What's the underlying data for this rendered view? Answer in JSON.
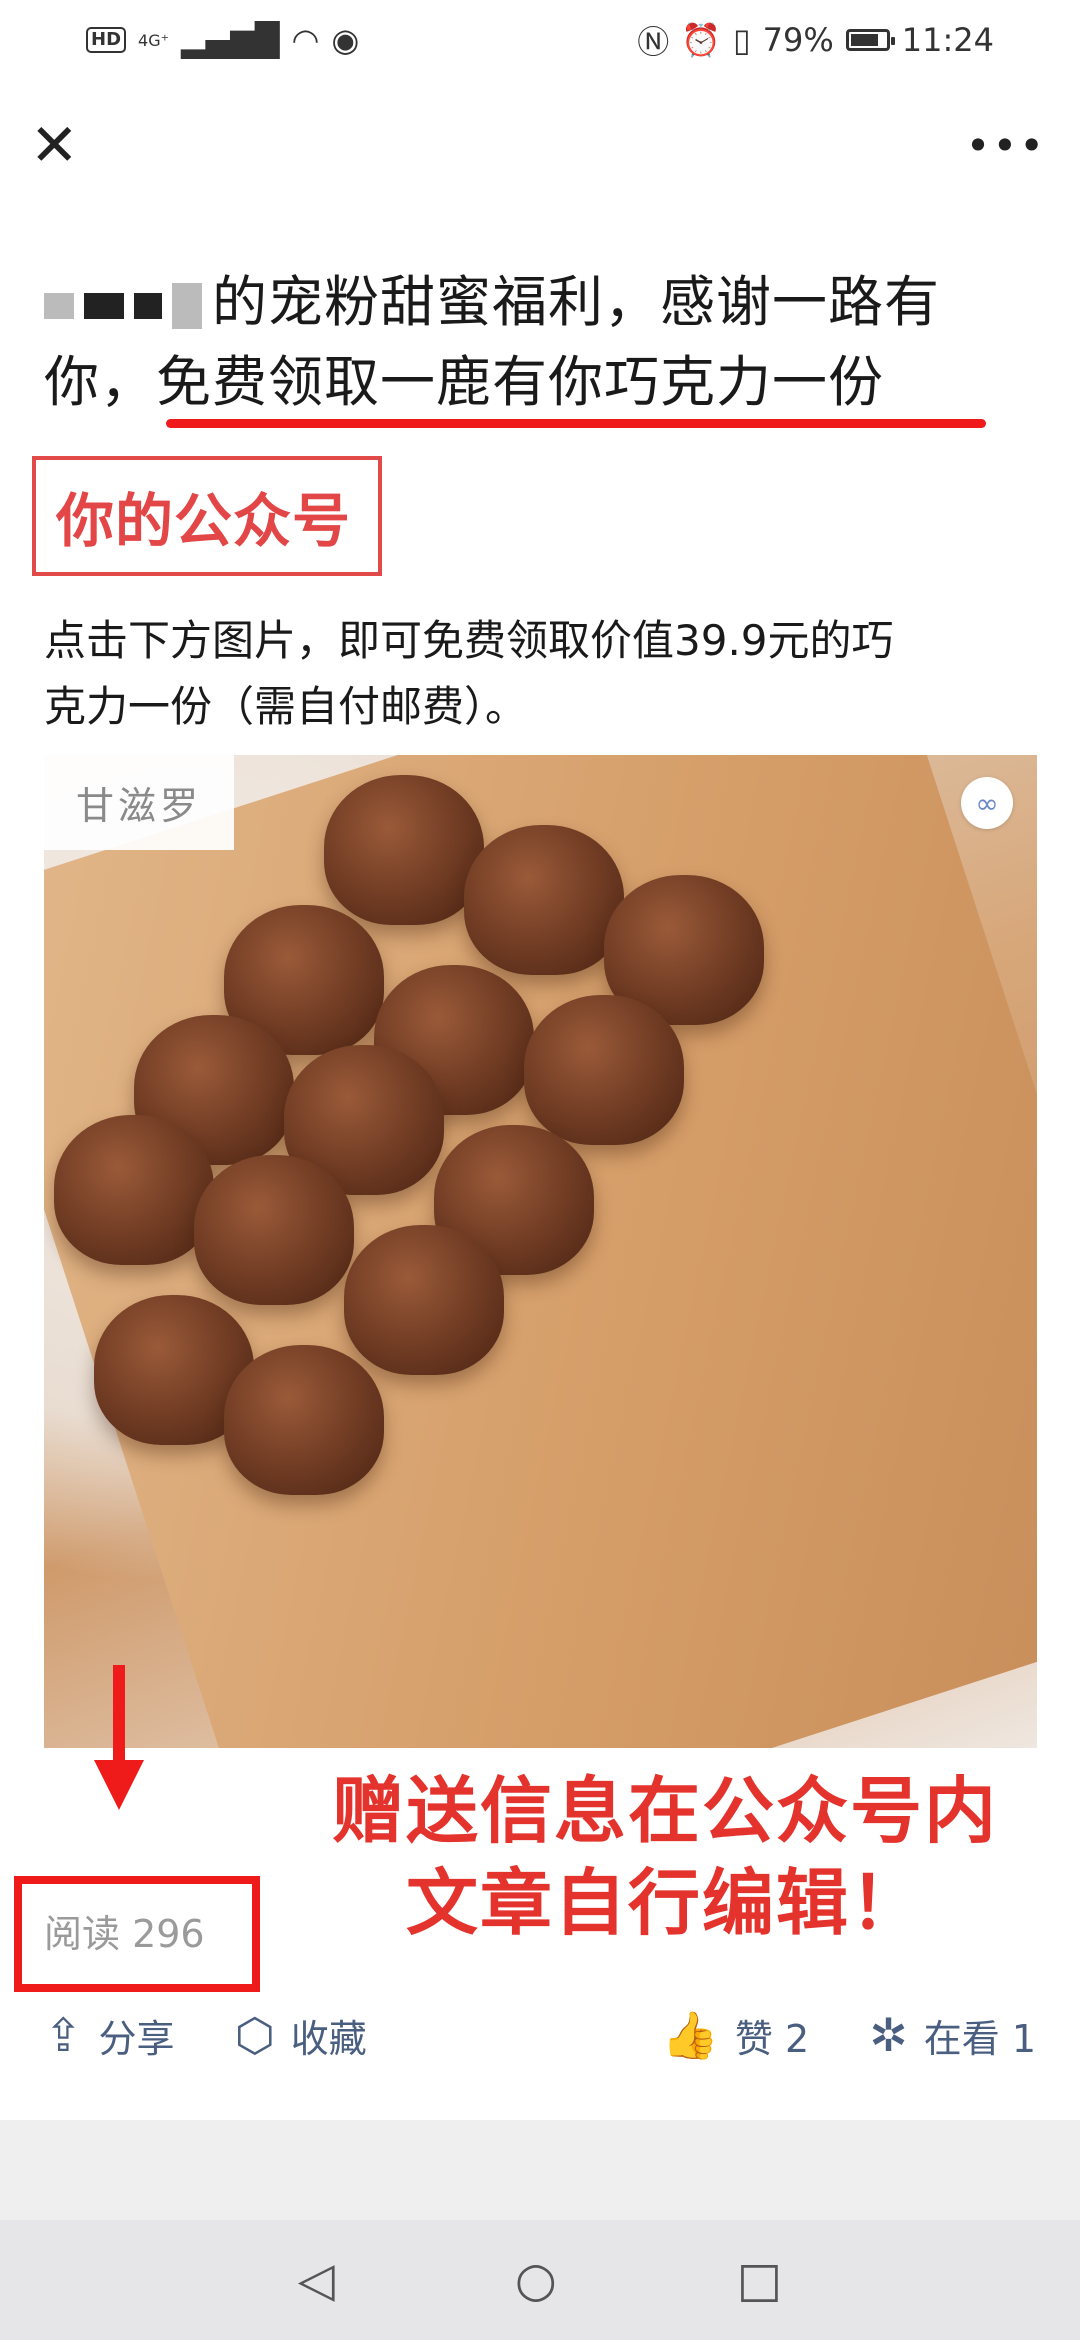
{
  "status_bar": {
    "network": "HD",
    "signal": "4G⁺",
    "battery": "79%",
    "battery_level": 0.79,
    "time": "11:24"
  },
  "nav": {
    "close_icon": "close-icon",
    "more_icon": "more-icon"
  },
  "article": {
    "title_line1": "的宠粉甜蜜福利，感谢一路有",
    "title_line2_prefix": "你，",
    "title_line2_highlight": "免费领取一鹿有你巧克力一份",
    "account_label": "你的公众号",
    "body_line1": "点击下方图片，即可免费领取价值39.9元的巧",
    "body_line2": "克力一份（需自付邮费）。",
    "image_brand": "甘滋罗",
    "annotation_line1": "赠送信息在公众号内",
    "annotation_line2": "文章自行编辑！",
    "read_count": "阅读 296"
  },
  "actions": {
    "share": "分享",
    "favorite": "收藏",
    "like": "赞 2",
    "watching": "在看 1"
  },
  "colors": {
    "annotation_red": "#ef1b1b",
    "action_blue": "#4a5e80"
  }
}
